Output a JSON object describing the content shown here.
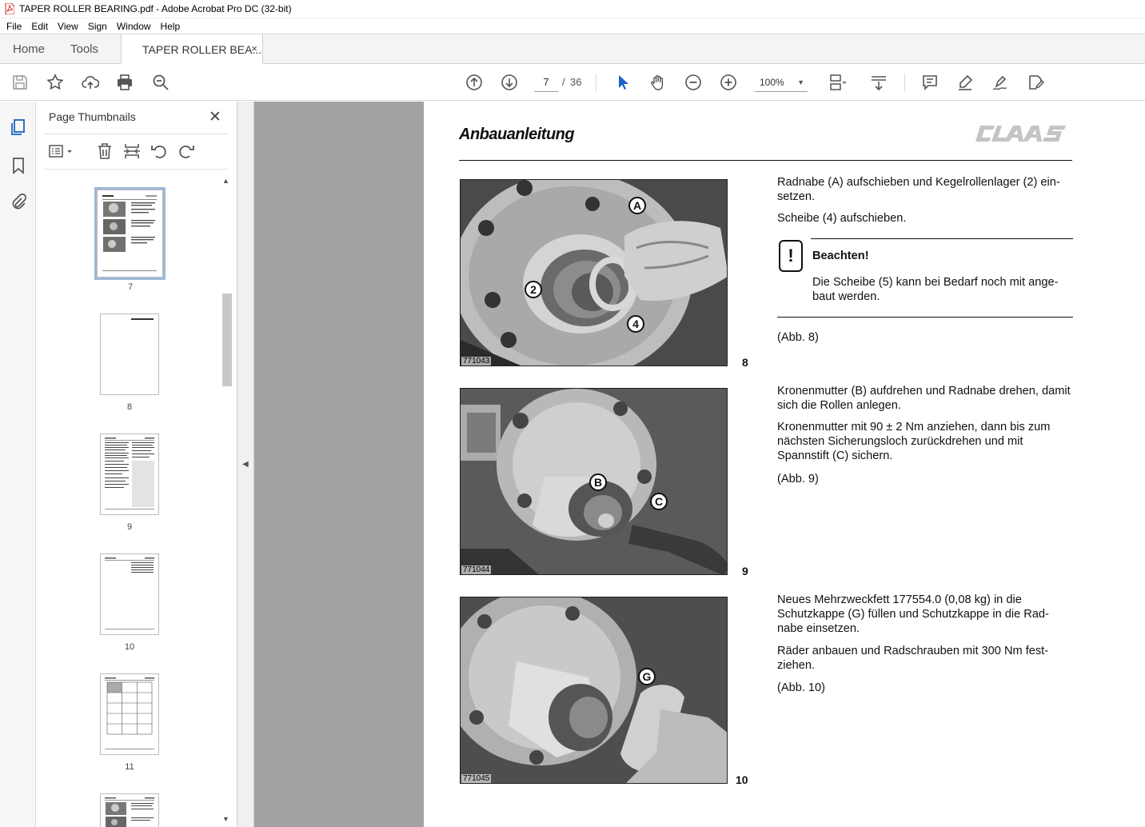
{
  "window": {
    "title": "TAPER ROLLER BEARING.pdf - Adobe Acrobat Pro DC (32-bit)"
  },
  "menu": [
    "File",
    "Edit",
    "View",
    "Sign",
    "Window",
    "Help"
  ],
  "tabs": {
    "home": "Home",
    "tools": "Tools",
    "document": "TAPER ROLLER BEA...",
    "close": "×"
  },
  "toolbar": {
    "current_page": "7",
    "separator": "/",
    "total_pages": "36",
    "zoom": "100%"
  },
  "thumbnails_panel": {
    "title": "Page Thumbnails",
    "close": "✕",
    "pages": [
      "7",
      "8",
      "9",
      "10",
      "11"
    ]
  },
  "document": {
    "heading": "Anbauanleitung",
    "brand_logo": "CLAAS",
    "figures": [
      {
        "id": "771043",
        "number": "8",
        "callouts": [
          "A",
          "2",
          "4"
        ]
      },
      {
        "id": "771044",
        "number": "9",
        "callouts": [
          "B",
          "C"
        ]
      },
      {
        "id": "771045",
        "number": "10",
        "callouts": [
          "G"
        ]
      }
    ],
    "section1": {
      "p1": "Radnabe (A) aufschieben und Kegelrollenlager (2) ein-setzen.",
      "p2": "Scheibe (4) aufschieben.",
      "note_title": "Beachten!",
      "note_text": "Die Scheibe (5) kann bei Bedarf noch mit ange-baut werden.",
      "ref": "(Abb. 8)"
    },
    "section2": {
      "p1": "Kronenmutter (B) aufdrehen und Radnabe drehen, damit sich die Rollen anlegen.",
      "p2": "Kronenmutter mit 90 ± 2 Nm anziehen, dann bis zum nächsten Sicherungsloch zurückdrehen und mit Spannstift (C) sichern.",
      "ref": "(Abb. 9)"
    },
    "section3": {
      "p1": "Neues Mehrzweckfett 177554.0 (0,08 kg) in die Schutzkappe (G) füllen und Schutzkappe in die Rad-nabe einsetzen.",
      "p2": "Räder anbauen und Radschrauben mit 300 Nm fest-ziehen.",
      "ref": "(Abb. 10)"
    }
  },
  "colors": {
    "accent_red": "#d0281c",
    "nav_blue": "#1a62c4",
    "canvas_gray": "#a3a3a3"
  }
}
